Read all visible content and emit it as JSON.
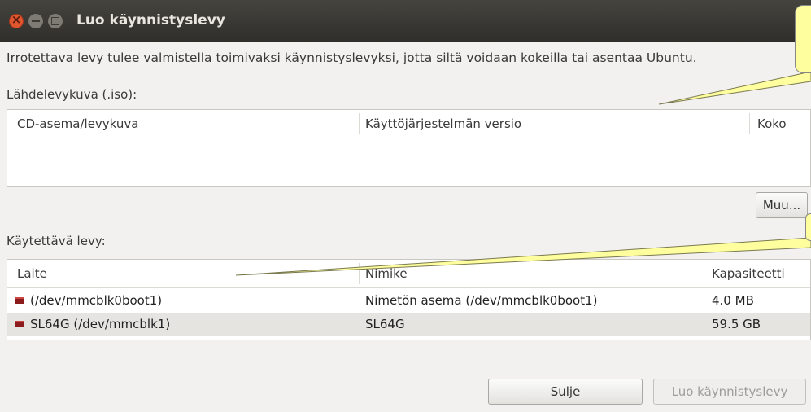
{
  "window": {
    "title": "Luo käynnistyslevy"
  },
  "description": "Irrotettava levy tulee valmistella toimivaksi käynnistyslevyksi, jotta siltä voidaan kokeilla tai asentaa Ubuntu.",
  "source": {
    "label": "Lähdelevykuva (.iso):",
    "columns": [
      "CD-asema/levykuva",
      "Käyttöjärjestelmän versio",
      "Koko"
    ],
    "other_button": "Muu..."
  },
  "target": {
    "label": "Käytettävä levy:",
    "columns": [
      "Laite",
      "Nimike",
      "Kapasiteetti"
    ],
    "rows": [
      {
        "device": "(/dev/mmcblk0boot1)",
        "name": "Nimetön asema (/dev/mmcblk0boot1)",
        "capacity": "4.0 MB"
      },
      {
        "device": "SL64G (/dev/mmcblk1)",
        "name": "SL64G",
        "capacity": "59.5 GB"
      }
    ]
  },
  "buttons": {
    "close": "Sulje",
    "create": "Luo käynnistyslevy"
  },
  "colors": {
    "titlebar": "#3c3b37",
    "close_button": "#e2562f",
    "callout": "#fefe9e",
    "selected_row": "#e5e4e1"
  }
}
